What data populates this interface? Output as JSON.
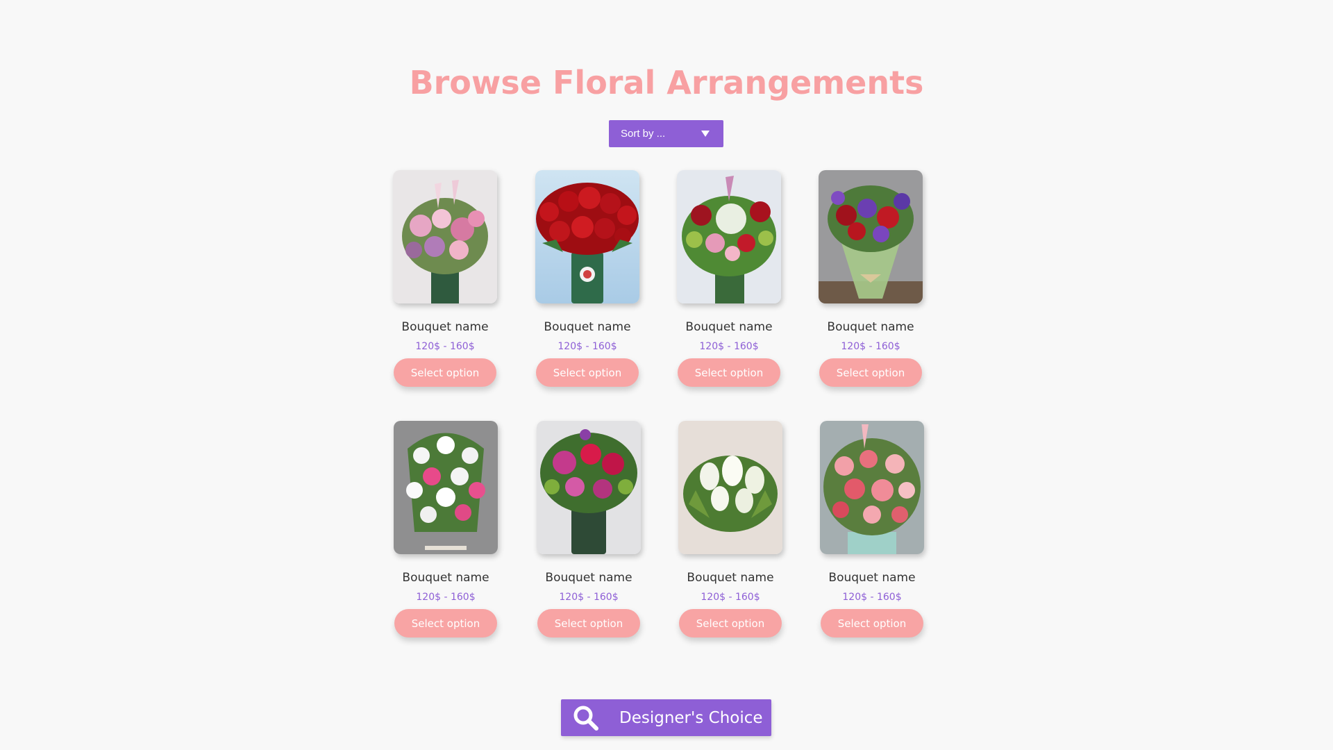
{
  "page": {
    "title": "Browse Floral Arrangements"
  },
  "sort": {
    "label": "Sort by ..."
  },
  "products": [
    {
      "name": "Bouquet name",
      "price": "120$ - 160$",
      "button": "Select option",
      "image": "pink-lily-bouquet"
    },
    {
      "name": "Bouquet name",
      "price": "120$ - 160$",
      "button": "Select option",
      "image": "red-rose-vase"
    },
    {
      "name": "Bouquet name",
      "price": "120$ - 160$",
      "button": "Select option",
      "image": "mixed-rose-hydrangea"
    },
    {
      "name": "Bouquet name",
      "price": "120$ - 160$",
      "button": "Select option",
      "image": "wrapped-purple-red-bouquet"
    },
    {
      "name": "Bouquet name",
      "price": "120$ - 160$",
      "button": "Select option",
      "image": "white-pink-basket"
    },
    {
      "name": "Bouquet name",
      "price": "120$ - 160$",
      "button": "Select option",
      "image": "magenta-mixed-vase"
    },
    {
      "name": "Bouquet name",
      "price": "120$ - 160$",
      "button": "Select option",
      "image": "white-tulip-bouquet"
    },
    {
      "name": "Bouquet name",
      "price": "120$ - 160$",
      "button": "Select option",
      "image": "pink-garden-arrangement"
    }
  ],
  "designer_choice": {
    "label": "Designer's Choice",
    "icon": "search-icon"
  },
  "colors": {
    "accent_purple": "#8e5fd6",
    "accent_pink": "#f8a4a4",
    "title_pink": "#f8a0a2",
    "background": "#f8f8f8"
  }
}
